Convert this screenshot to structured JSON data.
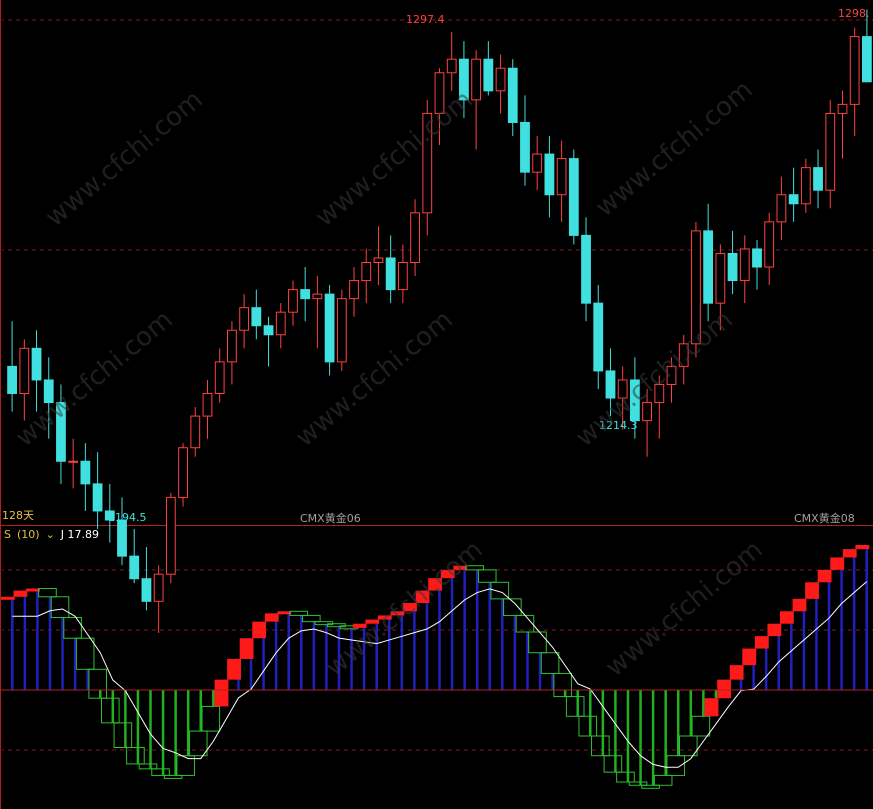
{
  "chart_data": [
    {
      "type": "candlestick",
      "instrument_labels": [
        "CMX黄金06",
        "CMX黄金08"
      ],
      "period_label": "128天",
      "annotations": {
        "high_1": "1297.4",
        "high_2": "1298.",
        "low_1": "1194.5",
        "low_2": "1214.3"
      },
      "ylim": [
        1188,
        1302
      ],
      "candles": [
        [
          1222,
          1232,
          1212,
          1216
        ],
        [
          1216,
          1228,
          1210,
          1226
        ],
        [
          1226,
          1230,
          1212,
          1219
        ],
        [
          1219,
          1224,
          1206,
          1214
        ],
        [
          1214,
          1218,
          1196,
          1201
        ],
        [
          1201,
          1206,
          1195,
          1201
        ],
        [
          1201,
          1205,
          1190,
          1196
        ],
        [
          1196,
          1203,
          1186,
          1190
        ],
        [
          1190,
          1196,
          1183,
          1188
        ],
        [
          1188,
          1193,
          1178,
          1180
        ],
        [
          1180,
          1186,
          1174,
          1175
        ],
        [
          1175,
          1182,
          1168,
          1170
        ],
        [
          1170,
          1178,
          1163,
          1176
        ],
        [
          1176,
          1194,
          1174,
          1193
        ],
        [
          1193,
          1205,
          1191,
          1204
        ],
        [
          1204,
          1213,
          1202,
          1211
        ],
        [
          1211,
          1219,
          1206,
          1216
        ],
        [
          1216,
          1226,
          1214,
          1223
        ],
        [
          1223,
          1232,
          1218,
          1230
        ],
        [
          1230,
          1238,
          1226,
          1235
        ],
        [
          1235,
          1239,
          1228,
          1231
        ],
        [
          1231,
          1233,
          1222,
          1229
        ],
        [
          1229,
          1236,
          1226,
          1234
        ],
        [
          1234,
          1241,
          1231,
          1239
        ],
        [
          1239,
          1244,
          1232,
          1237
        ],
        [
          1237,
          1242,
          1226,
          1238
        ],
        [
          1238,
          1240,
          1220,
          1223
        ],
        [
          1223,
          1239,
          1221,
          1237
        ],
        [
          1237,
          1244,
          1233,
          1241
        ],
        [
          1241,
          1248,
          1236,
          1245
        ],
        [
          1245,
          1253,
          1240,
          1246
        ],
        [
          1246,
          1251,
          1236,
          1239
        ],
        [
          1239,
          1249,
          1236,
          1245
        ],
        [
          1245,
          1259,
          1242,
          1256
        ],
        [
          1256,
          1281,
          1251,
          1278
        ],
        [
          1278,
          1288,
          1271,
          1287
        ],
        [
          1287,
          1296,
          1283,
          1290
        ],
        [
          1290,
          1294,
          1277,
          1281
        ],
        [
          1281,
          1292,
          1270,
          1290
        ],
        [
          1290,
          1294,
          1282,
          1283
        ],
        [
          1283,
          1291,
          1278,
          1288
        ],
        [
          1288,
          1290,
          1273,
          1276
        ],
        [
          1276,
          1282,
          1262,
          1265
        ],
        [
          1265,
          1273,
          1261,
          1269
        ],
        [
          1269,
          1273,
          1255,
          1260
        ],
        [
          1260,
          1272,
          1254,
          1268
        ],
        [
          1268,
          1270,
          1249,
          1251
        ],
        [
          1251,
          1255,
          1232,
          1236
        ],
        [
          1236,
          1240,
          1217,
          1221
        ],
        [
          1221,
          1226,
          1211,
          1215
        ],
        [
          1215,
          1222,
          1208,
          1219
        ],
        [
          1219,
          1224,
          1206,
          1210
        ],
        [
          1210,
          1217,
          1202,
          1214
        ],
        [
          1214,
          1220,
          1206,
          1218
        ],
        [
          1218,
          1224,
          1214,
          1222
        ],
        [
          1222,
          1229,
          1218,
          1227
        ],
        [
          1227,
          1254,
          1224,
          1252
        ],
        [
          1252,
          1258,
          1232,
          1236
        ],
        [
          1236,
          1249,
          1230,
          1247
        ],
        [
          1247,
          1252,
          1238,
          1241
        ],
        [
          1241,
          1251,
          1236,
          1248
        ],
        [
          1248,
          1250,
          1239,
          1244
        ],
        [
          1244,
          1256,
          1240,
          1254
        ],
        [
          1254,
          1264,
          1250,
          1260
        ],
        [
          1260,
          1266,
          1254,
          1258
        ],
        [
          1258,
          1268,
          1256,
          1266
        ],
        [
          1266,
          1270,
          1257,
          1261
        ],
        [
          1261,
          1281,
          1257,
          1278
        ],
        [
          1278,
          1283,
          1268,
          1280
        ],
        [
          1280,
          1297,
          1273,
          1295
        ],
        [
          1295,
          1301,
          1287,
          1285
        ]
      ]
    },
    {
      "type": "bar",
      "title": "S",
      "param": "(10)",
      "value_label": "J 17.89",
      "ylim": [
        -70,
        70
      ],
      "values": [
        45,
        48,
        49,
        45,
        35,
        25,
        10,
        -5,
        -20,
        -35,
        -45,
        -48,
        -52,
        -52,
        -40,
        -25,
        -10,
        5,
        15,
        25,
        33,
        37,
        38,
        36,
        33,
        32,
        31,
        30,
        32,
        34,
        36,
        38,
        42,
        48,
        54,
        58,
        60,
        58,
        52,
        44,
        36,
        28,
        18,
        8,
        -4,
        -16,
        -28,
        -40,
        -50,
        -56,
        -58,
        -58,
        -52,
        -40,
        -28,
        -16,
        -5,
        5,
        12,
        20,
        26,
        32,
        38,
        44,
        52,
        58,
        64,
        68,
        70
      ]
    }
  ],
  "watermark": "www.cfchi.com"
}
